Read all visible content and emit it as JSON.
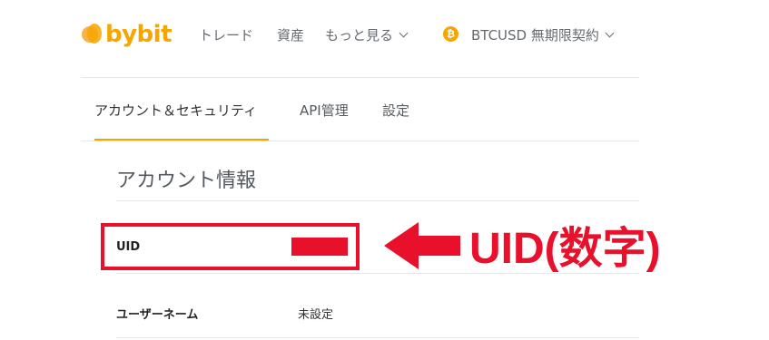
{
  "header": {
    "logo_text": "bybit",
    "nav": [
      {
        "label": "トレード"
      },
      {
        "label": "資産"
      },
      {
        "label": "もっと見る"
      }
    ],
    "contract": {
      "icon_glyph": "₿",
      "label": "BTCUSD 無期限契約"
    }
  },
  "tabs": [
    {
      "label": "アカウント＆セキュリティ",
      "active": true
    },
    {
      "label": "API管理",
      "active": false
    },
    {
      "label": "設定",
      "active": false
    }
  ],
  "account": {
    "title": "アカウント情報",
    "rows": [
      {
        "label": "UID",
        "value_redacted": true
      },
      {
        "label": "ユーザーネーム",
        "value": "未設定"
      }
    ]
  },
  "annotation": {
    "text": "UID(数字)",
    "color": "#e8102a"
  },
  "colors": {
    "brand": "#f7a600",
    "annotation": "#e8102a"
  }
}
